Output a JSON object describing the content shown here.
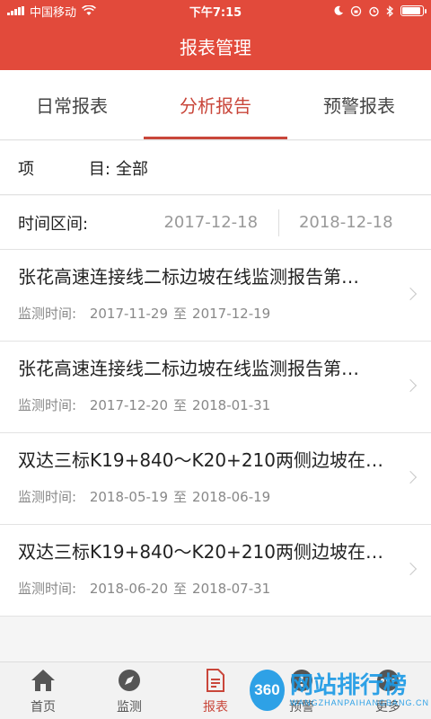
{
  "status_bar": {
    "carrier": "中国移动",
    "time": "下午7:15",
    "battery_level": 0.9
  },
  "header": {
    "title": "报表管理"
  },
  "tabs": [
    {
      "label": "日常报表",
      "active": false
    },
    {
      "label": "分析报告",
      "active": true
    },
    {
      "label": "预警报表",
      "active": false
    }
  ],
  "filters": {
    "project_label_a": "项",
    "project_label_b": "目:",
    "project_value": "全部",
    "range_label": "时间区间:",
    "start_date": "2017-12-18",
    "end_date": "2018-12-18"
  },
  "reports": [
    {
      "title": "张花高速连接线二标边坡在线监测报告第…",
      "meta_label": "监测时间:",
      "start": "2017-11-29",
      "to": "至",
      "end": "2017-12-19"
    },
    {
      "title": "张花高速连接线二标边坡在线监测报告第…",
      "meta_label": "监测时间:",
      "start": "2017-12-20",
      "to": "至",
      "end": "2018-01-31"
    },
    {
      "title": "双达三标K19+840～K20+210两侧边坡在…",
      "meta_label": "监测时间:",
      "start": "2018-05-19",
      "to": "至",
      "end": "2018-06-19"
    },
    {
      "title": "双达三标K19+840～K20+210两侧边坡在…",
      "meta_label": "监测时间:",
      "start": "2018-06-20",
      "to": "至",
      "end": "2018-07-31"
    }
  ],
  "bottom_nav": [
    {
      "label": "首页",
      "icon": "home-icon",
      "active": false
    },
    {
      "label": "监测",
      "icon": "compass-icon",
      "active": false
    },
    {
      "label": "报表",
      "icon": "report-icon",
      "active": true
    },
    {
      "label": "预警",
      "icon": "alert-icon",
      "active": false
    },
    {
      "label": "更多",
      "icon": "more-icon",
      "active": false
    }
  ],
  "watermark": {
    "badge": "360",
    "main": "网站排行榜",
    "sub": "WANGZHANPAIHANGBANG.CN"
  },
  "colors": {
    "brand": "#e24a3b",
    "accent": "#c9463a",
    "watermark": "#1e9be6"
  }
}
